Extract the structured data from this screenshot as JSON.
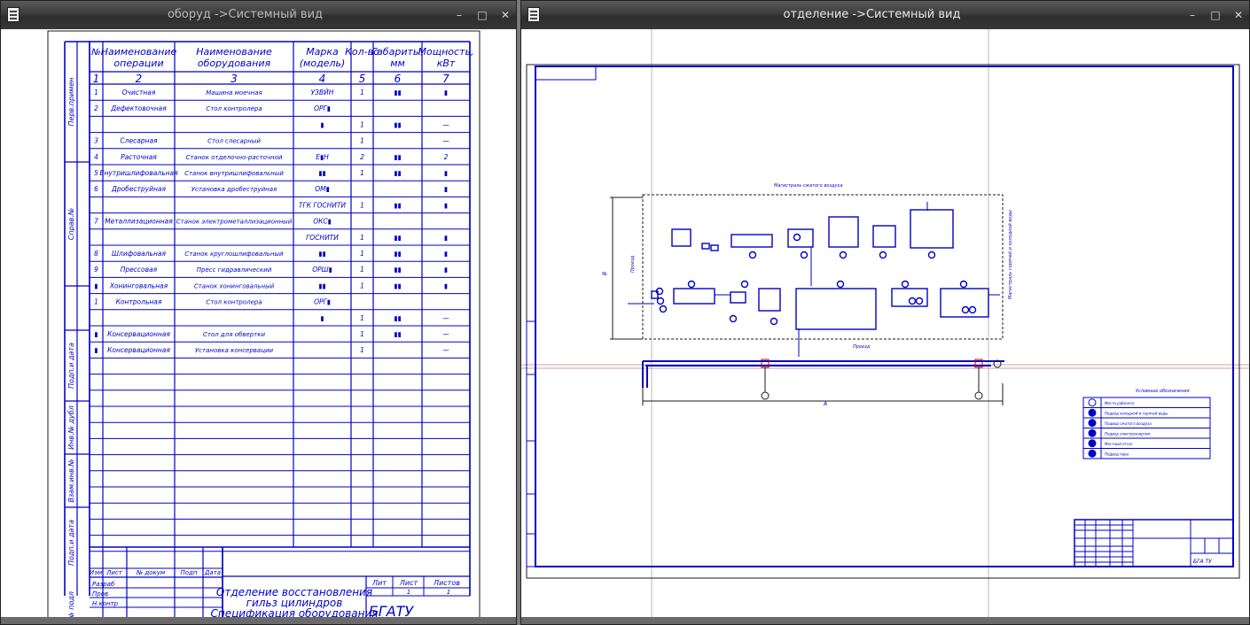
{
  "left_window": {
    "title": "оборуд ->Системный вид",
    "table_header": [
      "№",
      "Наименование операции",
      "Наименование оборудования",
      "Марка (модель)",
      "Кол-во",
      "Габариты, мм",
      "Мощность, кВт"
    ],
    "column_numbers": [
      "1",
      "2",
      "3",
      "4",
      "5",
      "6",
      "7"
    ],
    "rows": [
      {
        "n": "1",
        "op": "Очистная",
        "eq": "Машина моечная",
        "mark": "УЗВЙН",
        "qty": "1",
        "dim": "▮▮",
        "pwr": "▮"
      },
      {
        "n": "2",
        "op": "Дефектовочная",
        "eq": "Стол контролера",
        "mark": "ОРГ▮",
        "qty": "",
        "dim": "",
        "pwr": ""
      },
      {
        "n": "",
        "op": "",
        "eq": "",
        "mark": "▮",
        "qty": "1",
        "dim": "▮▮",
        "pwr": "—"
      },
      {
        "n": "3",
        "op": "Слесарная",
        "eq": "Стол слесарный",
        "mark": "",
        "qty": "1",
        "dim": "",
        "pwr": "—"
      },
      {
        "n": "4",
        "op": "Расточная",
        "eq": "Станок отделочно-расточной",
        "mark": "Е▮Н",
        "qty": "2",
        "dim": "▮▮",
        "pwr": "2"
      },
      {
        "n": "5",
        "op": "Внутришлифовальная",
        "eq": "Станок внутришлифовальный",
        "mark": "▮▮",
        "qty": "1",
        "dim": "▮▮",
        "pwr": "▮"
      },
      {
        "n": "6",
        "op": "Дробеструйная",
        "eq": "Установка дробеструйная",
        "mark": "ОМ▮",
        "qty": "",
        "dim": "",
        "pwr": "▮"
      },
      {
        "n": "",
        "op": "",
        "eq": "",
        "mark": "ТГК ГОСНИТИ",
        "qty": "1",
        "dim": "▮▮",
        "pwr": "▮"
      },
      {
        "n": "7",
        "op": "Металлизационная",
        "eq": "Станок электрометаллизационный",
        "mark": "ОКС▮",
        "qty": "",
        "dim": "",
        "pwr": ""
      },
      {
        "n": "",
        "op": "",
        "eq": "",
        "mark": "ГОСНИТИ",
        "qty": "1",
        "dim": "▮▮",
        "pwr": "▮"
      },
      {
        "n": "8",
        "op": "Шлифовальная",
        "eq": "Станок круглошлифовальный",
        "mark": "▮▮",
        "qty": "1",
        "dim": "▮▮",
        "pwr": "▮"
      },
      {
        "n": "9",
        "op": "Прессовая",
        "eq": "Пресс гидравлический",
        "mark": "ОРШ▮",
        "qty": "1",
        "dim": "▮▮",
        "pwr": "▮"
      },
      {
        "n": "▮",
        "op": "Хонинговальная",
        "eq": "Станок хонинговальный",
        "mark": "▮▮",
        "qty": "1",
        "dim": "▮▮",
        "pwr": "▮"
      },
      {
        "n": "1",
        "op": "Контрольная",
        "eq": "Стол контролера",
        "mark": "ОРГ▮",
        "qty": "",
        "dim": "",
        "pwr": ""
      },
      {
        "n": "",
        "op": "",
        "eq": "",
        "mark": "▮",
        "qty": "1",
        "dim": "▮▮",
        "pwr": "—"
      },
      {
        "n": "▮",
        "op": "Консервационная",
        "eq": "Стол для обвертки",
        "mark": "",
        "qty": "1",
        "dim": "▮▮",
        "pwr": "—"
      },
      {
        "n": "▮",
        "op": "Консервационная",
        "eq": "Установка консервации",
        "mark": "",
        "qty": "1",
        "dim": "",
        "pwr": "—"
      }
    ],
    "side_labels": [
      "Перв.примен",
      "Справ.№",
      "Подп.и дата",
      "Инв.№ дубл",
      "Взам.инв.№",
      "Подп.и дата",
      "Инв.№ подл"
    ],
    "stamp": {
      "headers": [
        "Изм",
        "Лист",
        "№ докум",
        "Подп",
        "Дата"
      ],
      "roles": [
        "Разраб",
        "Пров",
        "Н.контр"
      ],
      "title_lines": [
        "Отделение восстановления",
        "гильз цилиндров",
        "Спецификация оборудования"
      ],
      "lit_label": "Лит",
      "sheet_label": "Лист",
      "sheets_label": "Листов",
      "sheet_value": "1",
      "sheets_value": "1",
      "org": "БГАТУ"
    }
  },
  "right_window": {
    "title": "отделение ->Системный вид",
    "drawing": {
      "top_label": "Магистраль сжатого воздуха",
      "left_label": "Проезд",
      "bottom_label": "Проезд",
      "right_label": "Магистраль горячей и холодной воды",
      "dim_a": "А",
      "dim_b": "В",
      "legend_title": "Условные обозначения",
      "legend": [
        "Место рабочего",
        "Подвод холодной и горячей воды",
        "Подвод сжатого воздуха",
        "Подвод электроэнергии",
        "Местный отсос",
        "Подвод пара"
      ],
      "stamp_sheet": "БГА ТУ"
    }
  },
  "ui": {
    "minimize": "–",
    "maximize": "□",
    "close": "✕"
  }
}
